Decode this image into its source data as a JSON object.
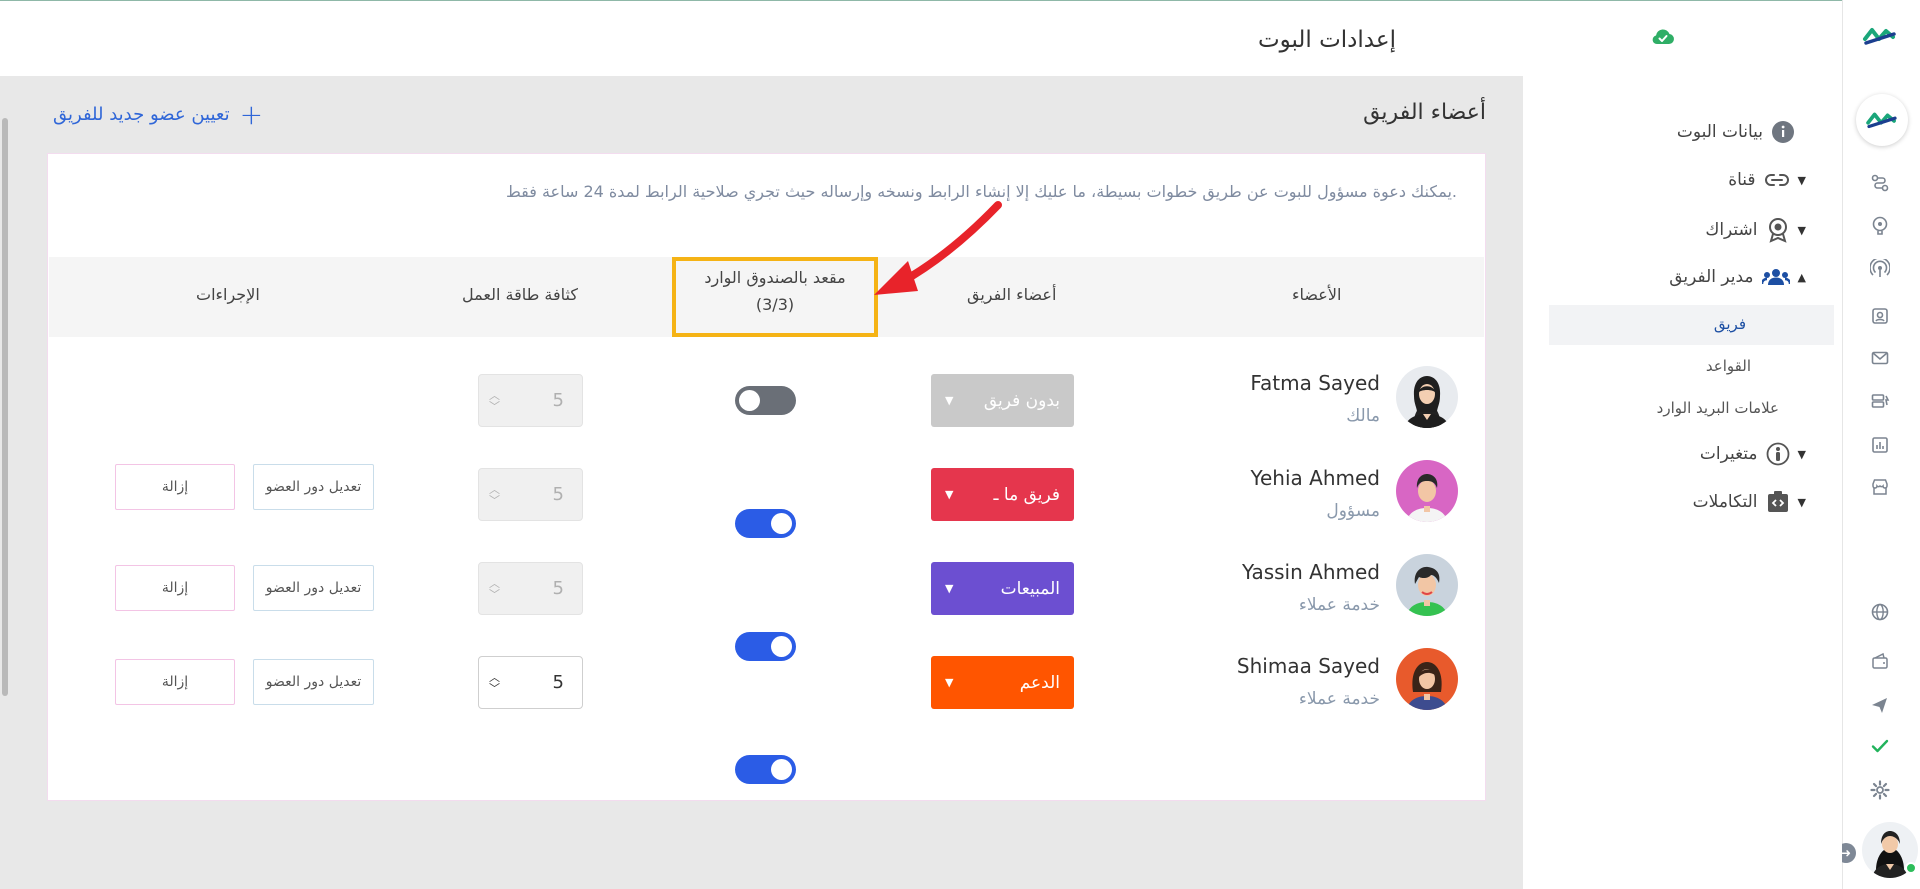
{
  "header": {
    "title": "إعدادات البوت",
    "status_icon": "cloud-check-icon"
  },
  "sidebar": {
    "items": [
      {
        "label": "بيانات البوت",
        "icon": "info-icon"
      },
      {
        "label": "قناة",
        "icon": "link-icon"
      },
      {
        "label": "اشتراك",
        "icon": "badge-icon"
      },
      {
        "label": "مدير الفريق",
        "icon": "users-icon"
      },
      {
        "label": "متغيرات",
        "icon": "variable-icon"
      },
      {
        "label": "التكاملات",
        "icon": "code-box-icon"
      }
    ],
    "subitems": [
      {
        "label": "فريق",
        "active": true
      },
      {
        "label": "القواعد"
      },
      {
        "label": "علامات البريد الوارد"
      }
    ]
  },
  "main": {
    "section_title": "أعضاء الفريق",
    "assign_link": "تعيين عضو جديد للفريق",
    "description": "يمكنك دعوة مسؤول للبوت عن طريق خطوات بسيطة، ما عليك إلا إنشاء الرابط ونسخه وإرساله حيث تجري صلاحية الرابط لمدة 24 ساعة فقط.",
    "columns": {
      "members": "الأعضاء",
      "team_members": "أعضاء الفريق",
      "inbox_seat": "مقعد بالصندوق الوارد",
      "inbox_seat_count": "(3/3)",
      "workload": "كثافة طاقة العمل",
      "actions": "الإجراءات"
    },
    "rows": [
      {
        "name": "Fatma Sayed",
        "role": "مالك",
        "team": "بدون فريق",
        "team_color": "#c9c9c9",
        "inbox_seat": false,
        "workload": "5",
        "stepper_enabled": false
      },
      {
        "name": "Yehia Ahmed",
        "role": "مسؤول",
        "team": "فريق ما ـ",
        "team_color": "#e5364d",
        "inbox_seat": true,
        "workload": "5",
        "stepper_enabled": false,
        "edit_label": "تعديل دور العضو",
        "remove_label": "إزالة"
      },
      {
        "name": "Yassin Ahmed",
        "role": "خدمة عملاء",
        "team": "المبيعات",
        "team_color": "#6c4fd1",
        "inbox_seat": true,
        "workload": "5",
        "stepper_enabled": false,
        "edit_label": "تعديل دور العضو",
        "remove_label": "إزالة"
      },
      {
        "name": "Shimaa Sayed",
        "role": "خدمة عملاء",
        "team": "الدعم",
        "team_color": "#ff5500",
        "inbox_seat": true,
        "workload": "5",
        "stepper_enabled": true,
        "edit_label": "تعديل دور العضو",
        "remove_label": "إزالة"
      }
    ]
  },
  "colors": {
    "accent": "#2f66d8",
    "toggle_on": "#2b5ce6",
    "toggle_off": "#6a6f77",
    "highlight": "#f5b315",
    "arrow": "#e8232a"
  }
}
